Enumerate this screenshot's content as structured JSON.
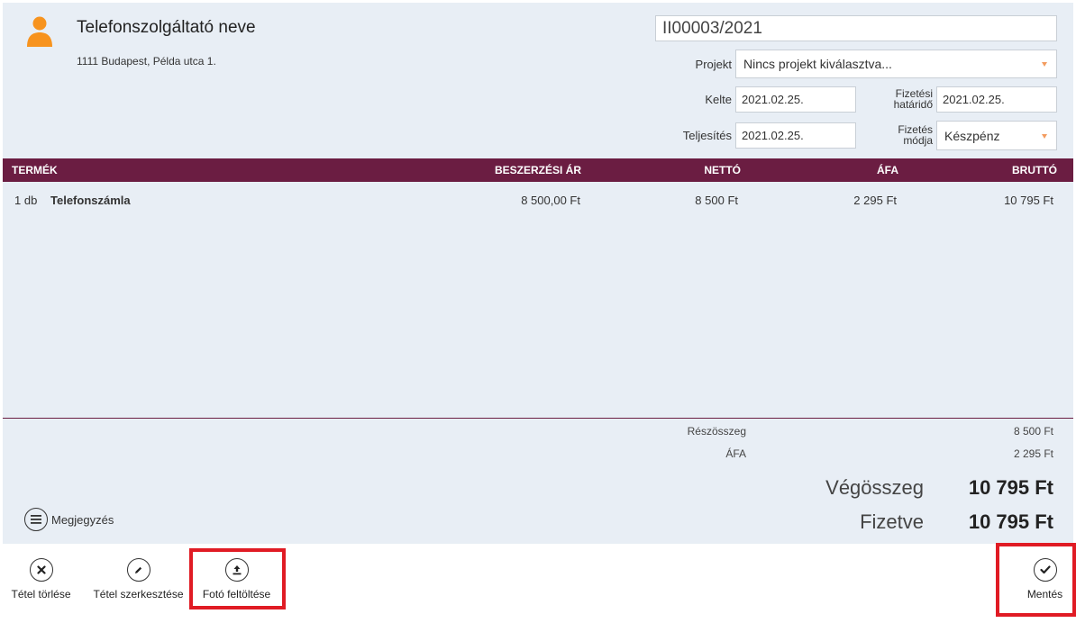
{
  "supplier": {
    "name": "Telefonszolgáltató neve",
    "address": "1111 Budapest, Példa utca 1.",
    "icon": "user-icon",
    "icon_color": "#f7931e"
  },
  "invoice": {
    "number": "II00003/2021",
    "project_label": "Projekt",
    "project_value": "Nincs projekt kiválasztva...",
    "date_label": "Kelte",
    "date_value": "2021.02.25.",
    "due_label_1": "Fizetési",
    "due_label_2": "határidő",
    "due_value": "2021.02.25.",
    "fulfilment_label": "Teljesítés",
    "fulfilment_value": "2021.02.25.",
    "payment_label_1": "Fizetés",
    "payment_label_2": "módja",
    "payment_value": "Készpénz"
  },
  "table": {
    "columns": [
      "TERMÉK",
      "BESZERZÉSI ÁR",
      "NETTÓ",
      "ÁFA",
      "BRUTTÓ"
    ],
    "header_color": "#6b1d42",
    "rows": [
      {
        "qty": "1 db",
        "product": "Telefonszámla",
        "purchase_price": "8 500,00 Ft",
        "net": "8 500 Ft",
        "vat": "2 295 Ft",
        "gross": "10 795 Ft"
      }
    ]
  },
  "summary": {
    "subtotal_label": "Részösszeg",
    "subtotal_value": "8 500 Ft",
    "vat_label": "ÁFA",
    "vat_value": "2 295 Ft",
    "total_label": "Végösszeg",
    "total_value": "10 795 Ft",
    "paid_label": "Fizetve",
    "paid_value": "10 795 Ft"
  },
  "note": {
    "label": "Megjegyzés",
    "icon": "menu-icon"
  },
  "actions": {
    "delete_label": "Tétel törlése",
    "edit_label": "Tétel szerkesztése",
    "upload_label": "Fotó feltöltése",
    "save_label": "Mentés"
  },
  "highlight_color": "#e01b24"
}
